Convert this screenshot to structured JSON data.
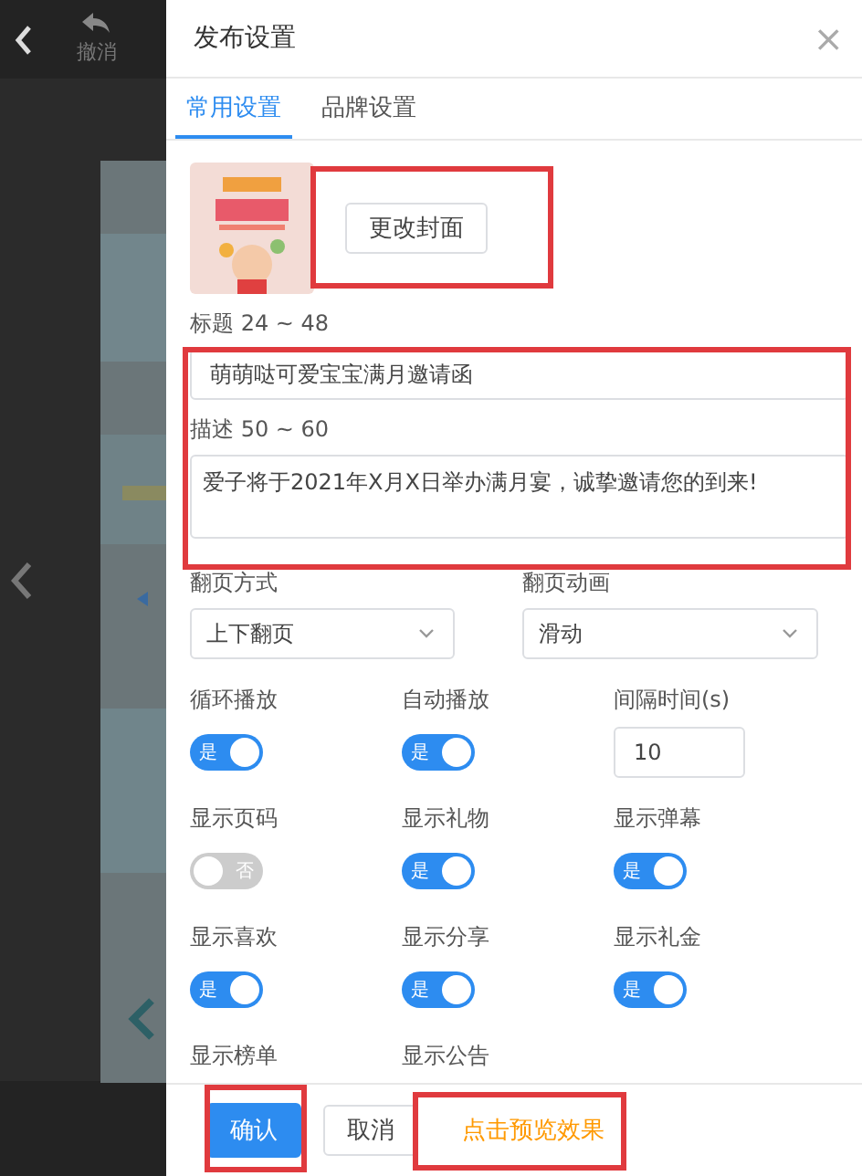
{
  "toolbar": {
    "undo_label": "撤消"
  },
  "dialog": {
    "title": "发布设置",
    "close": "×"
  },
  "tabs": [
    {
      "label": "常用设置",
      "selected": true
    },
    {
      "label": "品牌设置",
      "selected": false
    }
  ],
  "cover": {
    "kind": "picture",
    "button": "更改封面"
  },
  "title_field": {
    "label": "标题 24 ~ 48",
    "value": "萌萌哒可爱宝宝满月邀请函"
  },
  "description_field": {
    "label": "描述 50 ~ 60",
    "value": "爱子将于2021年X月X日举办满月宴，诚挚邀请您的到来!"
  },
  "selects": [
    {
      "label": "翻页方式",
      "value": "上下翻页"
    },
    {
      "label": "翻页动画",
      "value": "滑动"
    }
  ],
  "options": [
    {
      "kind": "toggle",
      "label": "循环播放",
      "on": true,
      "text": "是"
    },
    {
      "kind": "toggle",
      "label": "自动播放",
      "on": true,
      "text": "是"
    },
    {
      "kind": "number",
      "label": "间隔时间(s)",
      "value": "10"
    },
    {
      "kind": "toggle",
      "label": "显示页码",
      "on": false,
      "text": "否"
    },
    {
      "kind": "toggle",
      "label": "显示礼物",
      "on": true,
      "text": "是"
    },
    {
      "kind": "toggle",
      "label": "显示弹幕",
      "on": true,
      "text": "是"
    },
    {
      "kind": "toggle",
      "label": "显示喜欢",
      "on": true,
      "text": "是"
    },
    {
      "kind": "toggle",
      "label": "显示分享",
      "on": true,
      "text": "是"
    },
    {
      "kind": "toggle",
      "label": "显示礼金",
      "on": true,
      "text": "是"
    },
    {
      "kind": "label",
      "label": "显示榜单"
    },
    {
      "kind": "label",
      "label": "显示公告"
    }
  ],
  "footer": {
    "confirm": "确认",
    "cancel": "取消",
    "preview": "点击预览效果"
  }
}
